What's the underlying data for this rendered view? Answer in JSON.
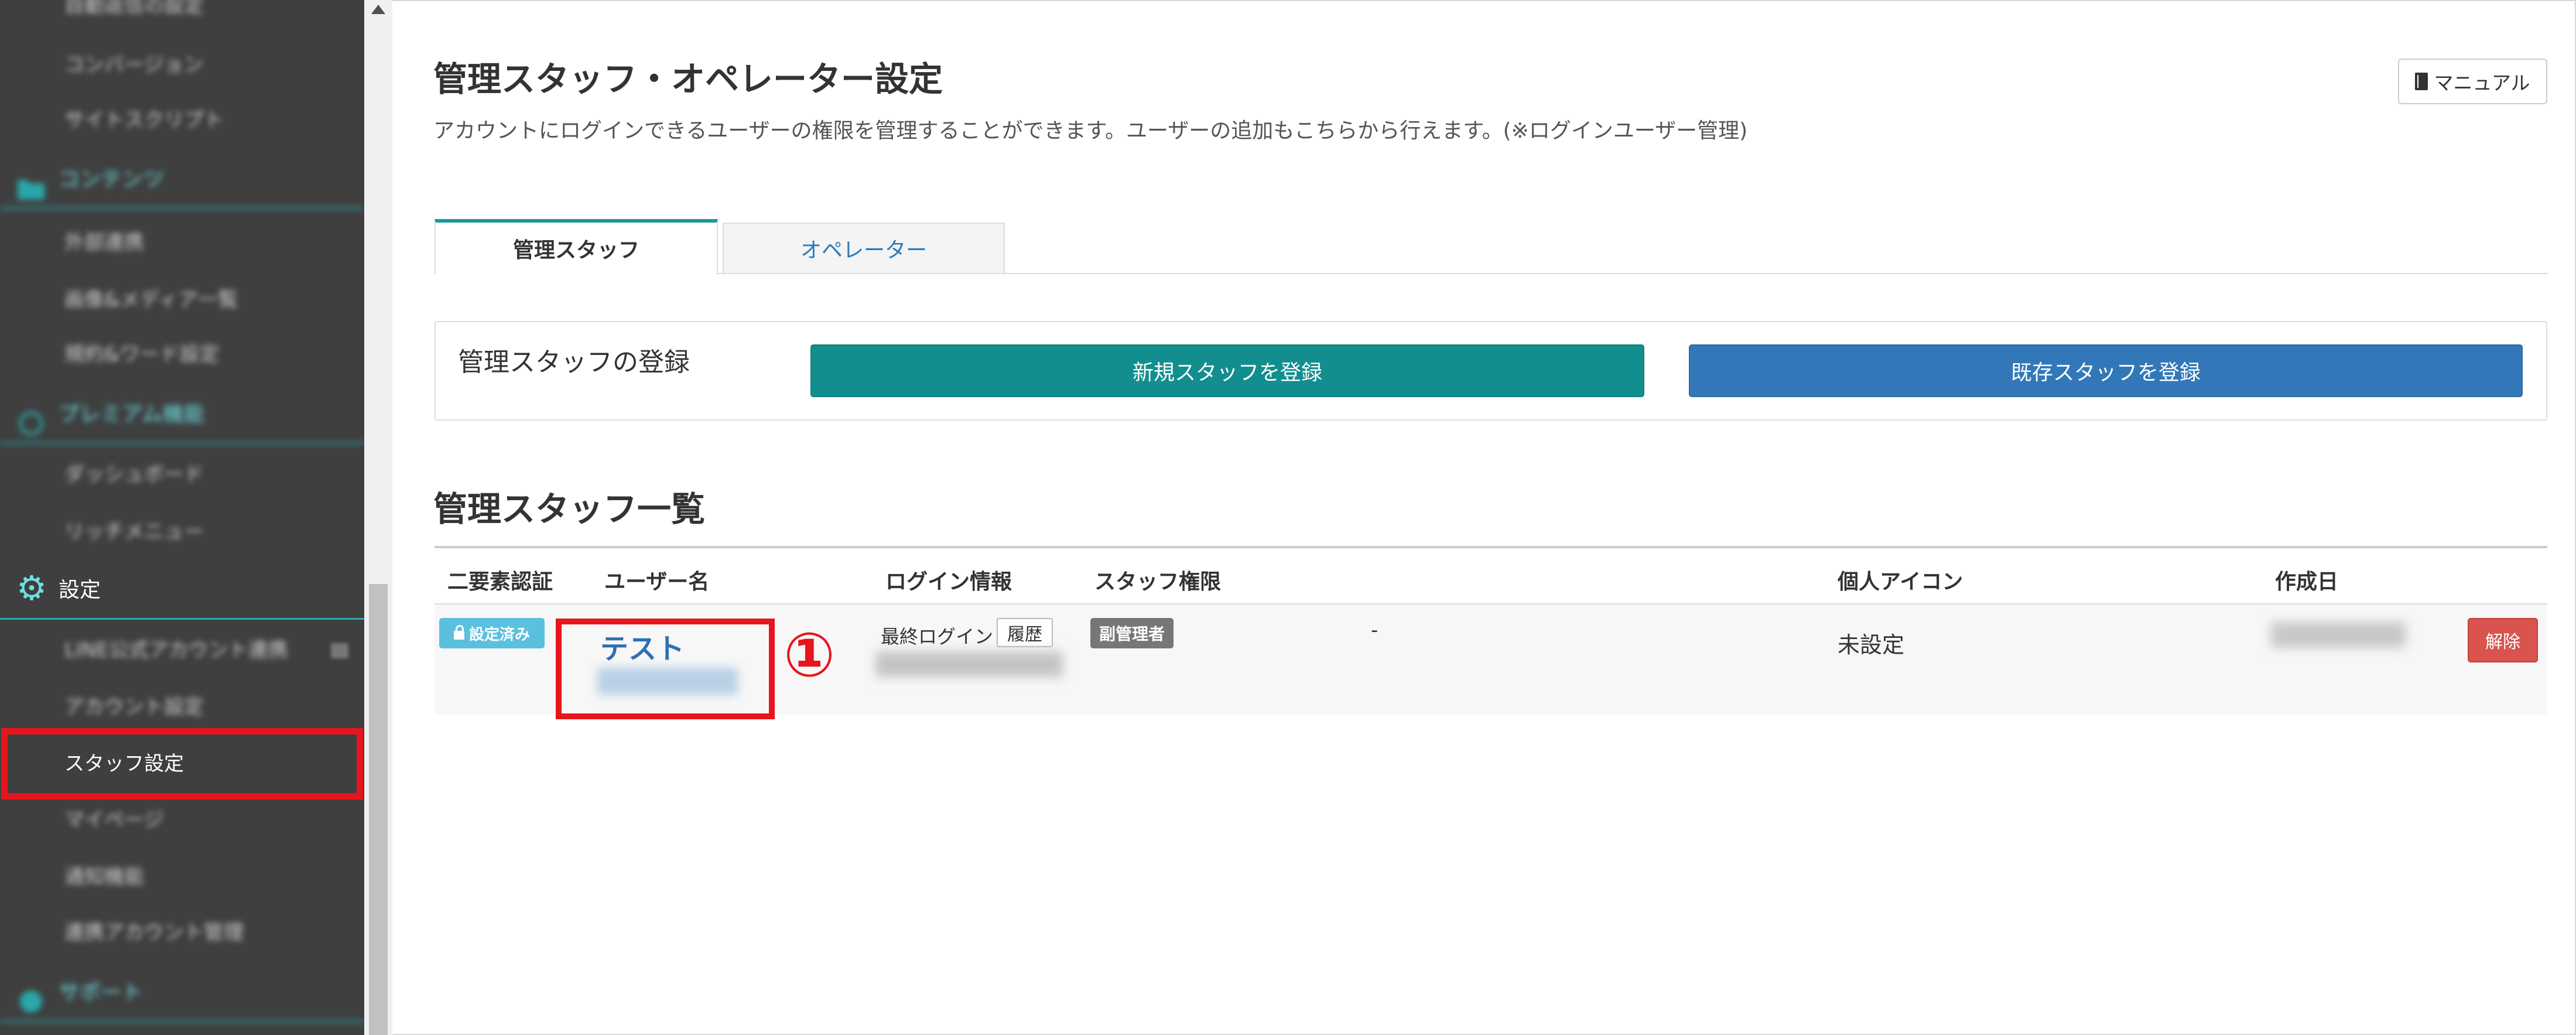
{
  "sidebar": {
    "items": [
      {
        "type": "sub",
        "label": "自動返信の設定",
        "blur": true
      },
      {
        "type": "sub",
        "label": "コンバージョン",
        "blur": true
      },
      {
        "type": "sub",
        "label": "サイトスクリプト",
        "blur": true
      },
      {
        "type": "section",
        "label": "コンテンツ",
        "blur": true,
        "icon": "folder-icon"
      },
      {
        "type": "sub",
        "label": "外部連携",
        "blur": true
      },
      {
        "type": "sub",
        "label": "画像&メディア一覧",
        "blur": true
      },
      {
        "type": "sub",
        "label": "規約&ワード設定",
        "blur": true
      },
      {
        "type": "section",
        "label": "プレミアム機能",
        "blur": true,
        "icon": "premium-icon"
      },
      {
        "type": "sub",
        "label": "ダッシュボード",
        "blur": true
      },
      {
        "type": "sub",
        "label": "リッチメニュー",
        "blur": true
      },
      {
        "type": "section",
        "label": "設定",
        "blur": false,
        "icon": "gear-icon"
      },
      {
        "type": "sub",
        "label": "LINE公式アカウント連携",
        "blur": true
      },
      {
        "type": "sub",
        "label": "アカウント設定",
        "blur": true
      },
      {
        "type": "sub",
        "label": "スタッフ設定",
        "blur": false,
        "current": true
      },
      {
        "type": "sub",
        "label": "マイページ",
        "blur": true
      },
      {
        "type": "sub",
        "label": "通知機能",
        "blur": true
      },
      {
        "type": "sub",
        "label": "連携アカウント管理",
        "blur": true
      },
      {
        "type": "section",
        "label": "サポート",
        "blur": true,
        "icon": "support-icon"
      }
    ]
  },
  "header": {
    "title": "管理スタッフ・オペレーター設定",
    "description": "アカウントにログインできるユーザーの権限を管理することができます。ユーザーの追加もこちらから行えます。(※ログインユーザー管理)",
    "manual_label": "マニュアル"
  },
  "tabs": [
    {
      "label": "管理スタッフ",
      "active": true
    },
    {
      "label": "オペレーター",
      "active": false
    }
  ],
  "registration": {
    "label": "管理スタッフの登録",
    "new_button": "新規スタッフを登録",
    "existing_button": "既存スタッフを登録"
  },
  "list": {
    "title": "管理スタッフ一覧",
    "columns": [
      "二要素認証",
      "ユーザー名",
      "ログイン情報",
      "スタッフ権限",
      "個人アイコン",
      "作成日"
    ],
    "rows": [
      {
        "mfa_badge": "設定済み",
        "user_name": "テスト",
        "last_login_label": "最終ログイン",
        "history_label": "履歴",
        "role": "副管理者",
        "role_extra": "-",
        "icon_status": "未設定",
        "delete_label": "解除"
      }
    ]
  },
  "annotation": {
    "marker": "①"
  },
  "colors": {
    "sidebar_bg": "#3f3f3f",
    "sidebar_accent": "#6ee0e3",
    "teal_button": "#138e8e",
    "blue_button": "#3278b8",
    "highlight_red": "#e8151d",
    "delete_red": "#d9534f",
    "mfa_badge": "#5bc0de",
    "role_badge": "#777777",
    "link_blue": "#2d6fb3"
  }
}
